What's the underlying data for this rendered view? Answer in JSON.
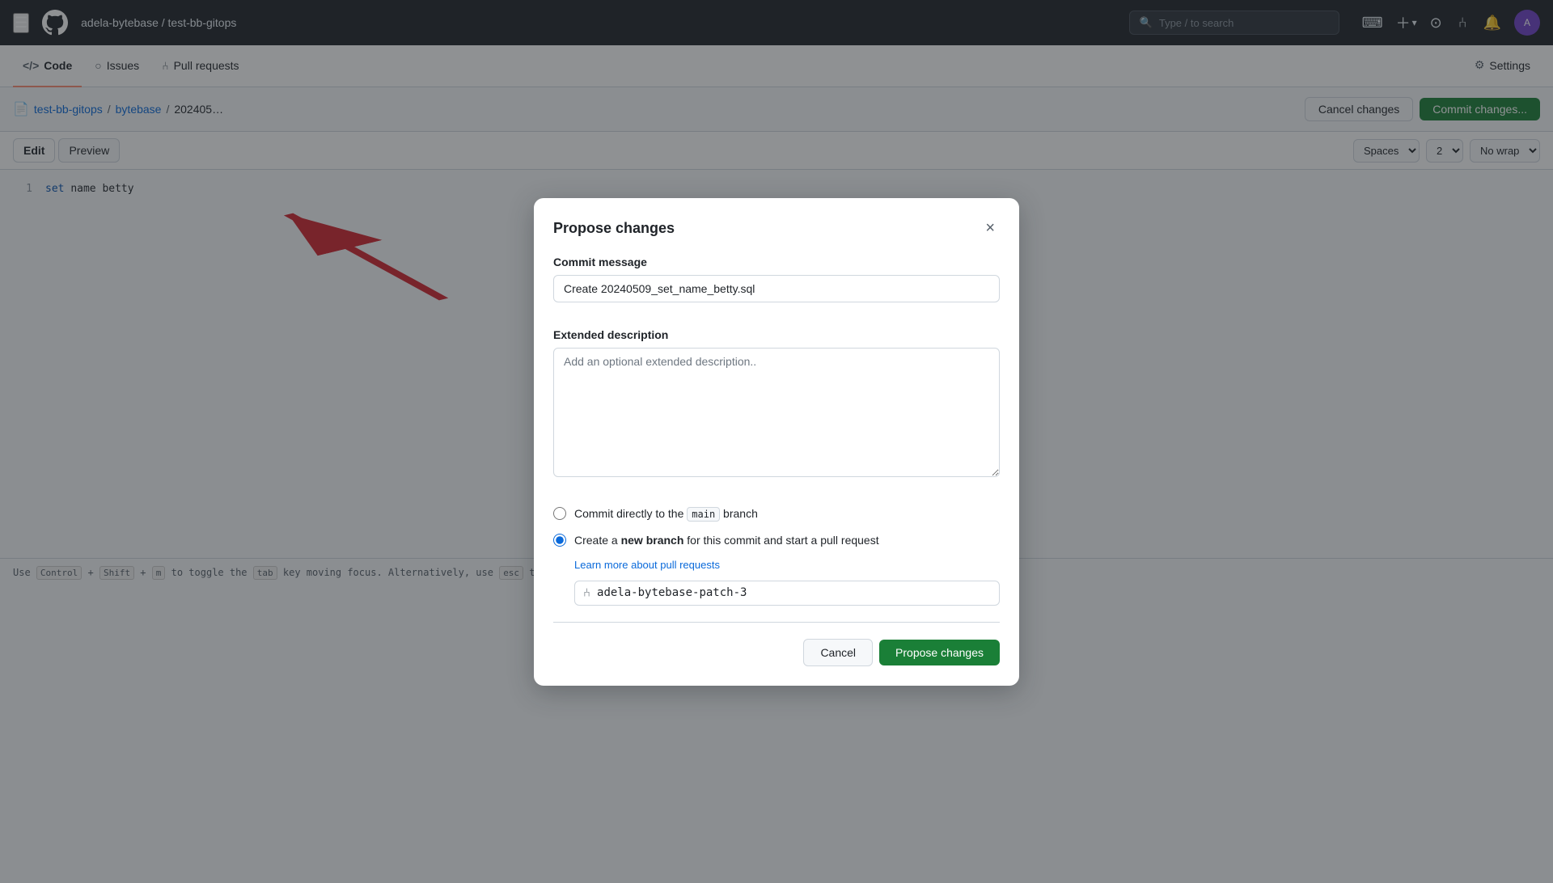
{
  "topnav": {
    "repo_path": "adela-bytebase / test-bb-gitops",
    "search_placeholder": "Type / to search",
    "search_shortcut": "/"
  },
  "subnav": {
    "items": [
      {
        "id": "code",
        "label": "Code",
        "icon": "</>",
        "active": true
      },
      {
        "id": "issues",
        "label": "Issues",
        "icon": "○"
      },
      {
        "id": "pull-requests",
        "label": "Pull requests",
        "icon": "⑃"
      },
      {
        "id": "settings",
        "label": "Settings",
        "icon": "⚙"
      }
    ]
  },
  "breadcrumb": {
    "repo_link": "test-bb-gitops",
    "folder_link": "bytebase",
    "file_partial": "202405…"
  },
  "toolbar": {
    "cancel_changes_label": "Cancel changes",
    "commit_changes_label": "Commit changes...",
    "edit_tab": "Edit",
    "preview_tab": "Preview",
    "spaces_label": "Spaces",
    "indent_value": "2",
    "wrap_label": "No wrap"
  },
  "editor": {
    "line1_number": "1",
    "line1_code": "set name betty"
  },
  "modal": {
    "title": "Propose changes",
    "close_label": "×",
    "commit_message_label": "Commit message",
    "commit_message_value": "Create 20240509_set_name_betty.sql",
    "extended_desc_label": "Extended description",
    "extended_desc_placeholder": "Add an optional extended description..",
    "radio_direct_label": "Commit directly to the ",
    "radio_direct_code": "main",
    "radio_direct_suffix": " branch",
    "radio_new_branch_label": "Create a ",
    "radio_new_branch_bold": "new branch",
    "radio_new_branch_suffix": " for this commit and start a pull request",
    "learn_more_label": "Learn more about pull requests",
    "branch_name": "adela-bytebase-patch-3",
    "cancel_label": "Cancel",
    "propose_label": "Propose changes"
  },
  "statusbar": {
    "text": "Use Control + Shift + m to toggle the tab key moving focus. Alternatively, use esc then tab to move to the next interactive element on the page."
  }
}
